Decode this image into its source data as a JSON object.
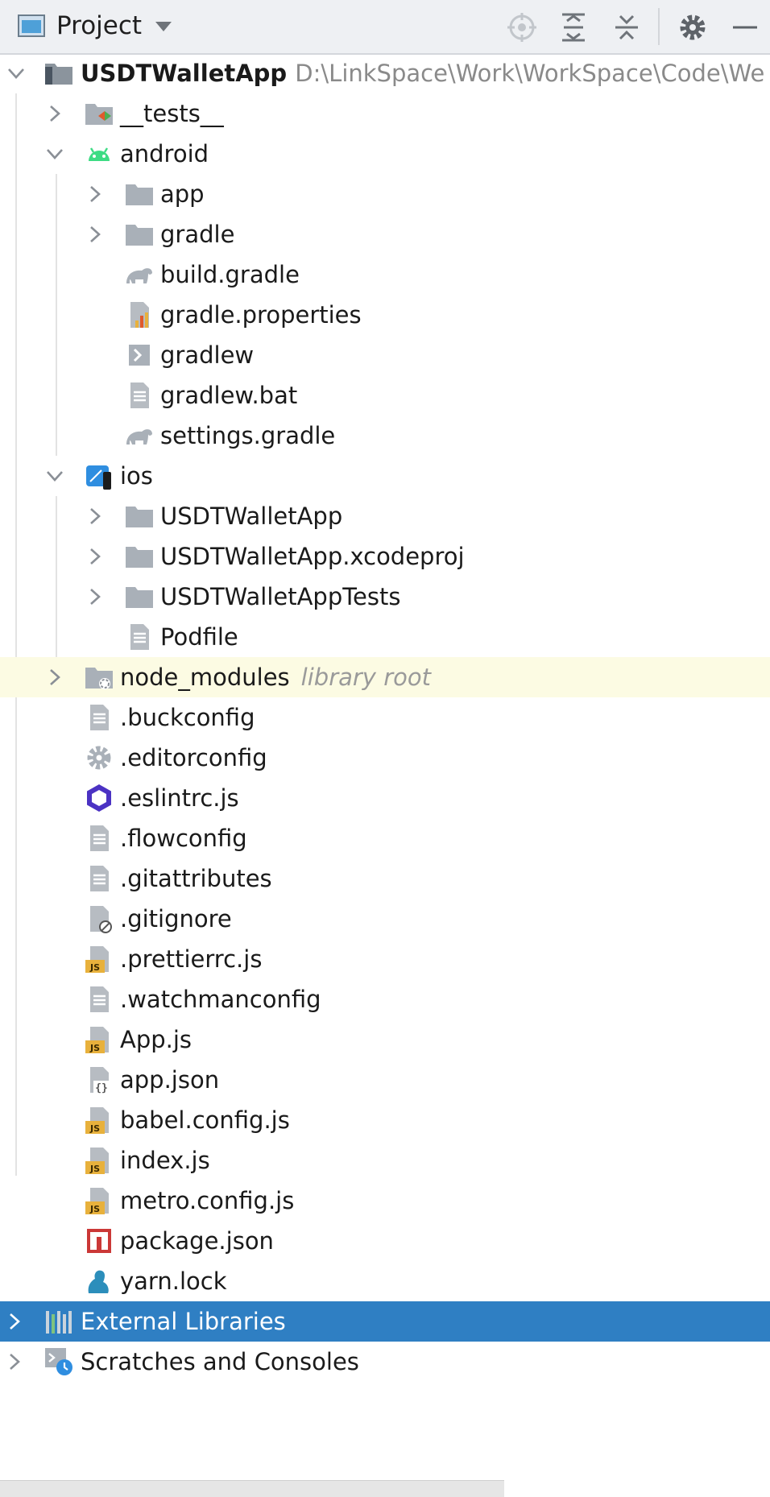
{
  "header": {
    "title": "Project",
    "icons": [
      "project-view-icon",
      "dropdown-caret-icon",
      "locate-icon",
      "expand-all-icon",
      "collapse-all-icon",
      "settings-gear-icon",
      "hide-minus-icon"
    ]
  },
  "tree": {
    "root": {
      "name": "USDTWalletApp",
      "path": "D:\\LinkSpace\\Work\\WorkSpace\\Code\\We"
    },
    "tests": "__tests__",
    "android": "android",
    "android_children": {
      "app": "app",
      "gradle": "gradle",
      "build_gradle": "build.gradle",
      "gradle_properties": "gradle.properties",
      "gradlew": "gradlew",
      "gradlew_bat": "gradlew.bat",
      "settings_gradle": "settings.gradle"
    },
    "ios": "ios",
    "ios_children": {
      "app": "USDTWalletApp",
      "xcodeproj": "USDTWalletApp.xcodeproj",
      "tests": "USDTWalletAppTests",
      "podfile": "Podfile"
    },
    "node_modules": {
      "name": "node_modules",
      "hint": "library root"
    },
    "files": {
      "buckconfig": ".buckconfig",
      "editorconfig": ".editorconfig",
      "eslintrc": ".eslintrc.js",
      "flowconfig": ".flowconfig",
      "gitattributes": ".gitattributes",
      "gitignore": ".gitignore",
      "prettierrc": ".prettierrc.js",
      "watchmanconfig": ".watchmanconfig",
      "app_js": "App.js",
      "app_json": "app.json",
      "babel": "babel.config.js",
      "index": "index.js",
      "metro": "metro.config.js",
      "package": "package.json",
      "yarn": "yarn.lock"
    },
    "external_libraries": "External Libraries",
    "scratches": "Scratches and Consoles"
  },
  "colors": {
    "selection": "#2f7fc3",
    "library_root_highlight": "#fcfbe3",
    "folder": "#a9b0b8",
    "js_badge": "#e8b13c"
  }
}
